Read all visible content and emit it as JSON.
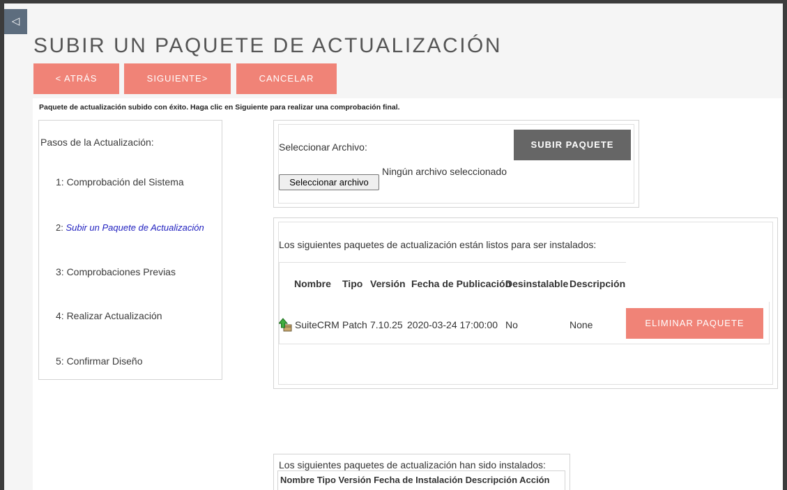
{
  "page": {
    "title": "SUBIR UN PAQUETE DE ACTUALIZACIÓN",
    "collapse_icon": "◁",
    "success_message": "Paquete de actualización subido con éxito. Haga clic en Siguiente para realizar una comprobación final."
  },
  "buttons": {
    "back": "< ATRÁS",
    "next": "SIGUIENTE>",
    "cancel": "CANCELAR",
    "upload": "SUBIR PAQUETE",
    "delete": "ELIMINAR PAQUETE"
  },
  "steps": {
    "title": "Pasos de la Actualización:",
    "items": [
      {
        "label": "1: Comprobación del Sistema"
      },
      {
        "num": "2: ",
        "label": "Subir un Paquete de Actualización"
      },
      {
        "label": "3: Comprobaciones Previas"
      },
      {
        "label": "4: Realizar Actualización"
      },
      {
        "label": "5: Confirmar Diseño"
      }
    ]
  },
  "upload": {
    "select_label": "Seleccionar Archivo:",
    "file_button": "Seleccionar archivo",
    "no_file": "Ningún archivo seleccionado"
  },
  "ready": {
    "text": "Los siguientes paquetes de actualización están listos para ser instalados:",
    "headers": [
      "Nombre",
      "Tipo",
      "Versión",
      "Fecha de Publicación",
      "Desinstalable",
      "Descripción"
    ],
    "row": {
      "name": "SuiteCRM",
      "type": "Patch",
      "version": "7.10.25",
      "date": "2020-03-24 17:00:00",
      "uninstallable": "No",
      "description": "None",
      "icon": "package-upload-icon"
    }
  },
  "installed": {
    "text": "Los siguientes paquetes de actualización han sido instalados:",
    "headers": "Nombre Tipo Versión Fecha de Instalación Descripción Acción"
  },
  "colors": {
    "accent": "#f08377",
    "upload_button": "#666666",
    "link": "#1f1fbf",
    "header_band": "#f5f5f5"
  }
}
